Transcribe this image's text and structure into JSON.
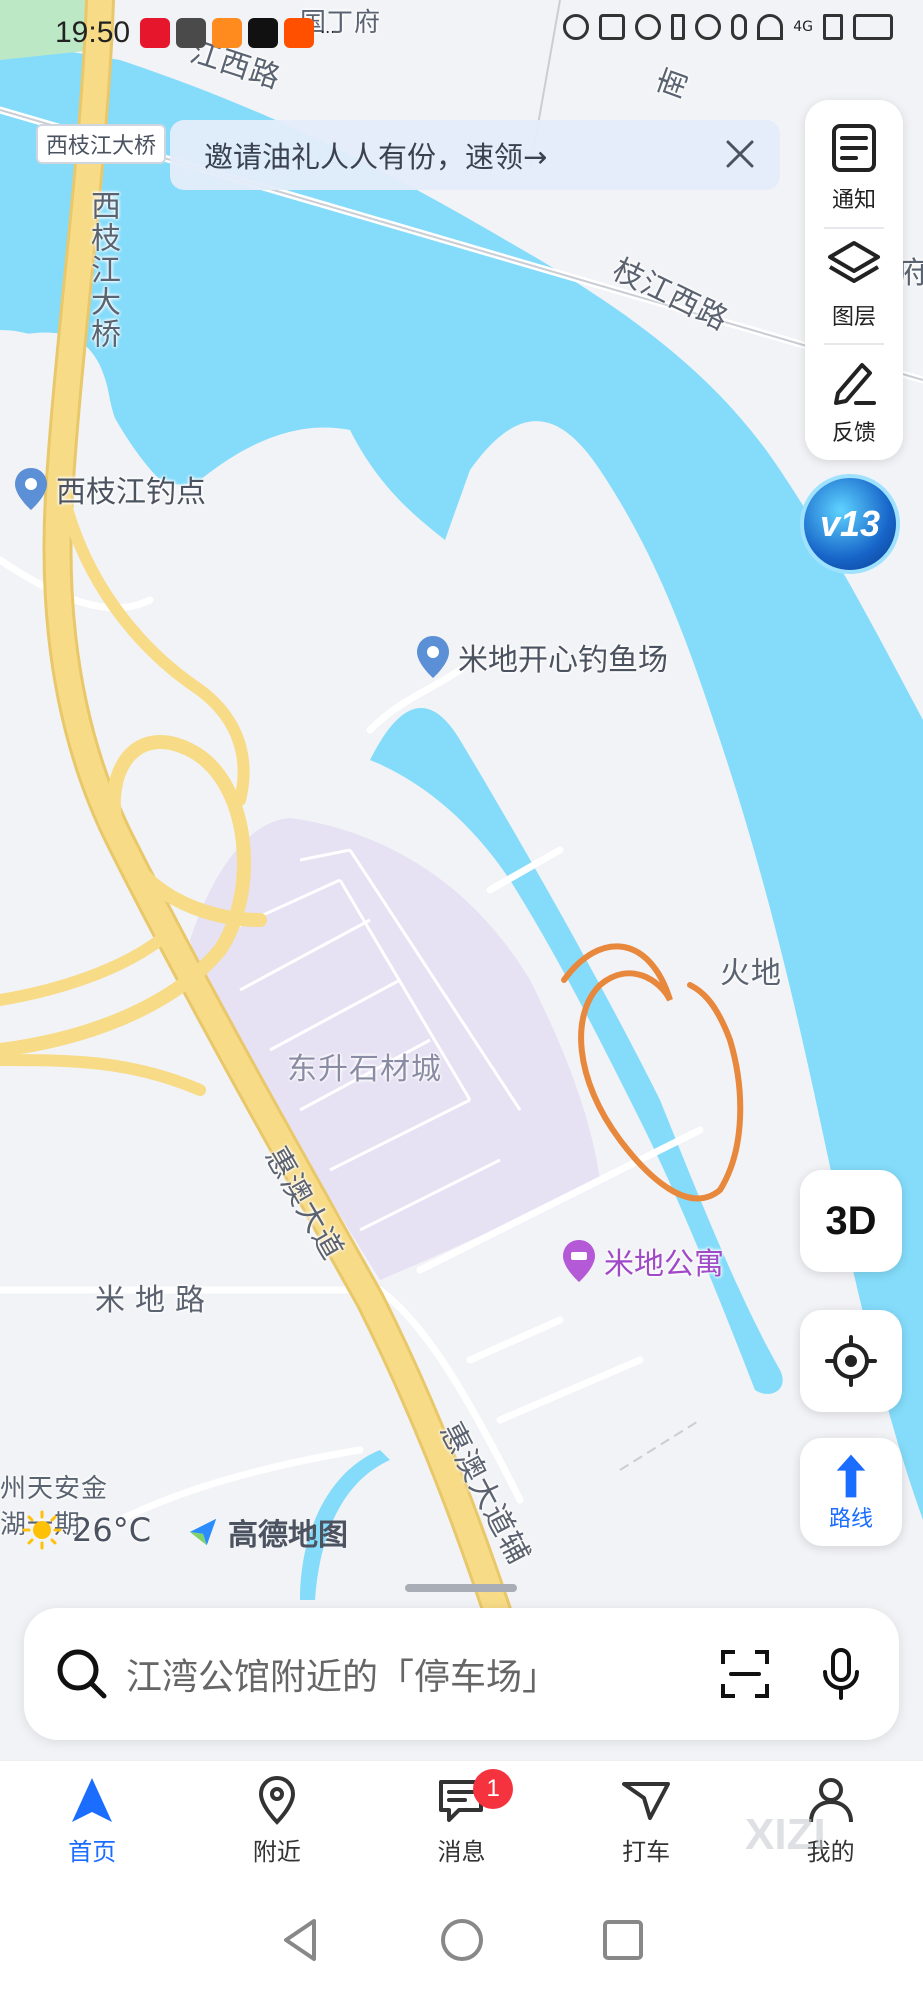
{
  "status_bar": {
    "time": "19:50",
    "app_icons": [
      "weibo-icon",
      "wechat-icon",
      "video-app-icon",
      "tiktok-icon",
      "taobao-icon"
    ],
    "more": "...",
    "indicators": [
      "eye-icon",
      "nfc-icon",
      "alarm-icon",
      "bluetooth-icon",
      "location-icon",
      "mic-icon",
      "wifi-icon",
      "signal-icon",
      "battery-icon"
    ],
    "network": "4G"
  },
  "banner": {
    "text": "邀请油礼人人有份，速领→",
    "close_icon": "close-icon"
  },
  "map": {
    "labels": {
      "west_bridge_tag": "西枝江大桥",
      "west_bridge_vertical": "西枝江大桥",
      "top_road": "江西路",
      "top_place": "国丁府",
      "south_road": "南",
      "zhijiang_road": "枝江西路",
      "right_edge": "府",
      "fire_land": "火地",
      "stone_city": "东升石材城",
      "huiao_road": "惠澳大道",
      "mi_di_road": "米地路",
      "huiao_aux_road": "惠澳大道辅",
      "tian_an": "州天安金",
      "tian_an_2": "湖一期"
    },
    "pois": [
      {
        "name": "西枝江钓点",
        "icon": "location-pin-icon"
      },
      {
        "name": "米地开心钓鱼场",
        "icon": "location-pin-icon"
      },
      {
        "name": "米地公寓",
        "icon": "hotel-pin-icon"
      }
    ],
    "badge_v13": "v13",
    "colors": {
      "water": "#84dcfa",
      "land": "#f2f3f6",
      "highway": "#f7db86",
      "district": "#e6e1f3",
      "annotation": "#e8883d"
    }
  },
  "side_panel": {
    "items": [
      {
        "label": "通知",
        "icon": "notification-icon"
      },
      {
        "label": "图层",
        "icon": "layers-icon"
      },
      {
        "label": "反馈",
        "icon": "feedback-edit-icon"
      }
    ]
  },
  "controls": {
    "three_d": "3D",
    "locate_icon": "locate-icon",
    "route_label": "路线",
    "route_icon": "route-arrow-icon"
  },
  "weather": {
    "icon": "sun-icon",
    "temperature": "26°C"
  },
  "brand": {
    "name": "高德地图",
    "icon": "amap-logo-icon"
  },
  "search": {
    "placeholder": "江湾公馆附近的「停车场」",
    "search_icon": "search-icon",
    "scan_icon": "scan-icon",
    "mic_icon": "mic-icon"
  },
  "tabbar": {
    "tabs": [
      {
        "label": "首页",
        "icon": "home-navigation-icon",
        "active": true
      },
      {
        "label": "附近",
        "icon": "nearby-pin-icon",
        "active": false
      },
      {
        "label": "消息",
        "icon": "message-icon",
        "active": false,
        "badge": "1"
      },
      {
        "label": "打车",
        "icon": "taxi-icon",
        "active": false
      },
      {
        "label": "我的",
        "icon": "profile-icon",
        "active": false
      }
    ]
  },
  "watermark": "XIZI",
  "system_nav": [
    "back-icon",
    "home-icon",
    "recents-icon"
  ]
}
